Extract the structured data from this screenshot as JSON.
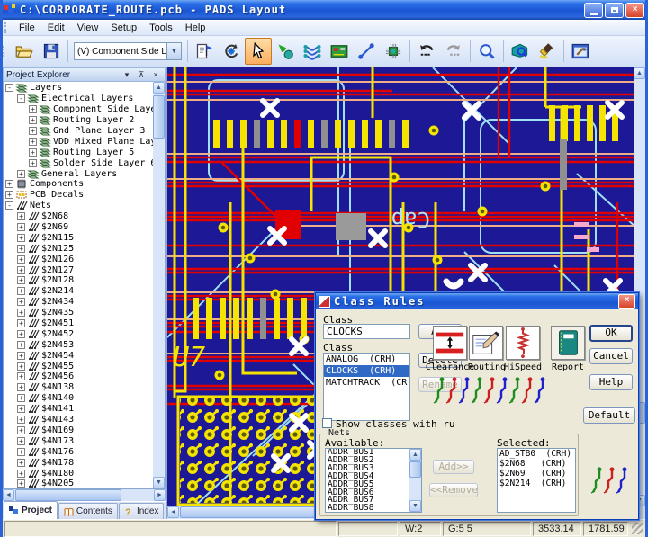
{
  "window": {
    "title": "C:\\CORPORATE_ROUTE.pcb - PADS Layout",
    "buttons": {
      "minimize": "minimize",
      "maximize": "maximize",
      "close": "close"
    }
  },
  "menu": {
    "items": [
      "File",
      "Edit",
      "View",
      "Setup",
      "Tools",
      "Help"
    ]
  },
  "toolbar": {
    "layer_select": "(V) Component Side L",
    "icons": [
      "open-file",
      "save",
      "layer-combo",
      "selection-properties",
      "redraw",
      "selection-pointer",
      "design-toggle",
      "add-route",
      "board-layout",
      "measure",
      "add-component",
      "undo",
      "redo",
      "zoom",
      "board-overview",
      "copper-pour",
      "toolbox"
    ]
  },
  "project_explorer": {
    "title": "Project Explorer",
    "tree": [
      {
        "label": "Layers",
        "depth": 0,
        "exp": "-",
        "icon": "#ic-layers"
      },
      {
        "label": "Electrical Layers",
        "depth": 1,
        "exp": "-",
        "icon": "#ic-layers"
      },
      {
        "label": "Component Side Laye",
        "depth": 2,
        "exp": "+",
        "icon": "#ic-layers"
      },
      {
        "label": "Routing Layer 2",
        "depth": 2,
        "exp": "+",
        "icon": "#ic-layers"
      },
      {
        "label": "Gnd Plane Layer 3",
        "depth": 2,
        "exp": "+",
        "icon": "#ic-layers"
      },
      {
        "label": "VDD Mixed Plane Lay",
        "depth": 2,
        "exp": "+",
        "icon": "#ic-layers"
      },
      {
        "label": "Routing Layer 5",
        "depth": 2,
        "exp": "+",
        "icon": "#ic-layers"
      },
      {
        "label": "Solder Side Layer 6",
        "depth": 2,
        "exp": "+",
        "icon": "#ic-layers"
      },
      {
        "label": "General Layers",
        "depth": 1,
        "exp": "+",
        "icon": "#ic-layers"
      },
      {
        "label": "Components",
        "depth": 0,
        "exp": "+",
        "icon": "#ic-comp"
      },
      {
        "label": "PCB Decals",
        "depth": 0,
        "exp": "+",
        "icon": "#ic-decal"
      },
      {
        "label": "Nets",
        "depth": 0,
        "exp": "-",
        "icon": "#ic-net"
      },
      {
        "label": "$2N68",
        "depth": 1,
        "exp": "+",
        "icon": "#ic-net"
      },
      {
        "label": "$2N69",
        "depth": 1,
        "exp": "+",
        "icon": "#ic-net"
      },
      {
        "label": "$2N115",
        "depth": 1,
        "exp": "+",
        "icon": "#ic-net"
      },
      {
        "label": "$2N125",
        "depth": 1,
        "exp": "+",
        "icon": "#ic-net"
      },
      {
        "label": "$2N126",
        "depth": 1,
        "exp": "+",
        "icon": "#ic-net"
      },
      {
        "label": "$2N127",
        "depth": 1,
        "exp": "+",
        "icon": "#ic-net"
      },
      {
        "label": "$2N128",
        "depth": 1,
        "exp": "+",
        "icon": "#ic-net"
      },
      {
        "label": "$2N214",
        "depth": 1,
        "exp": "+",
        "icon": "#ic-net"
      },
      {
        "label": "$2N434",
        "depth": 1,
        "exp": "+",
        "icon": "#ic-net"
      },
      {
        "label": "$2N435",
        "depth": 1,
        "exp": "+",
        "icon": "#ic-net"
      },
      {
        "label": "$2N451",
        "depth": 1,
        "exp": "+",
        "icon": "#ic-net"
      },
      {
        "label": "$2N452",
        "depth": 1,
        "exp": "+",
        "icon": "#ic-net"
      },
      {
        "label": "$2N453",
        "depth": 1,
        "exp": "+",
        "icon": "#ic-net"
      },
      {
        "label": "$2N454",
        "depth": 1,
        "exp": "+",
        "icon": "#ic-net"
      },
      {
        "label": "$2N455",
        "depth": 1,
        "exp": "+",
        "icon": "#ic-net"
      },
      {
        "label": "$2N456",
        "depth": 1,
        "exp": "+",
        "icon": "#ic-net"
      },
      {
        "label": "$4N138",
        "depth": 1,
        "exp": "+",
        "icon": "#ic-net"
      },
      {
        "label": "$4N140",
        "depth": 1,
        "exp": "+",
        "icon": "#ic-net"
      },
      {
        "label": "$4N141",
        "depth": 1,
        "exp": "+",
        "icon": "#ic-net"
      },
      {
        "label": "$4N143",
        "depth": 1,
        "exp": "+",
        "icon": "#ic-net"
      },
      {
        "label": "$4N169",
        "depth": 1,
        "exp": "+",
        "icon": "#ic-net"
      },
      {
        "label": "$4N173",
        "depth": 1,
        "exp": "+",
        "icon": "#ic-net"
      },
      {
        "label": "$4N176",
        "depth": 1,
        "exp": "+",
        "icon": "#ic-net"
      },
      {
        "label": "$4N178",
        "depth": 1,
        "exp": "+",
        "icon": "#ic-net"
      },
      {
        "label": "$4N180",
        "depth": 1,
        "exp": "+",
        "icon": "#ic-net"
      },
      {
        "label": "$4N205",
        "depth": 1,
        "exp": "+",
        "icon": "#ic-net"
      }
    ],
    "tabs": [
      {
        "label": "Project",
        "icon": "#ic-tab-project",
        "active": true
      },
      {
        "label": "Contents",
        "icon": "#ic-tab-contents",
        "active": false
      },
      {
        "label": "Index",
        "icon": "#ic-tab-index",
        "active": false
      }
    ]
  },
  "pcb": {
    "u7_label": "U7",
    "cap_label": "Cap"
  },
  "dialog": {
    "title": "Class Rules",
    "class_label": "Class",
    "class_value": "CLOCKS",
    "class_list_label": "Class",
    "classes": [
      {
        "label": "ANALOG  (CRH)",
        "selected": false
      },
      {
        "label": "CLOCKS  (CRH)",
        "selected": true
      },
      {
        "label": "MATCHTRACK  (CR",
        "selected": false
      }
    ],
    "buttons": {
      "add": "Add",
      "delete": "Delete",
      "rename": "Rename",
      "ok": "OK",
      "cancel": "Cancel",
      "help": "Help",
      "default": "Default",
      "add_net": "Add>>",
      "remove_net": "<<Remove"
    },
    "rules": [
      {
        "label": "Clearance"
      },
      {
        "label": "Routing"
      },
      {
        "label": "HiSpeed"
      },
      {
        "label": "Report"
      }
    ],
    "show_checkbox_label": "Show classes with ru",
    "nets": {
      "group_label": "Nets",
      "available_label": "Available:",
      "available": [
        "ADDR_BUS1",
        "ADDR_BUS2",
        "ADDR_BUS3",
        "ADDR_BUS4",
        "ADDR_BUS5",
        "ADDR_BUS6",
        "ADDR_BUS7",
        "ADDR_BUS8"
      ],
      "selected_label": "Selected:",
      "selected": [
        "AD_STB0  (CRH)",
        "$2N68   (CRH)",
        "$2N69   (CRH)",
        "$2N214  (CRH)"
      ]
    }
  },
  "statusbar": {
    "cells": [
      "",
      "W:2",
      "G:5 5",
      "3533.14",
      "1781.59"
    ]
  }
}
